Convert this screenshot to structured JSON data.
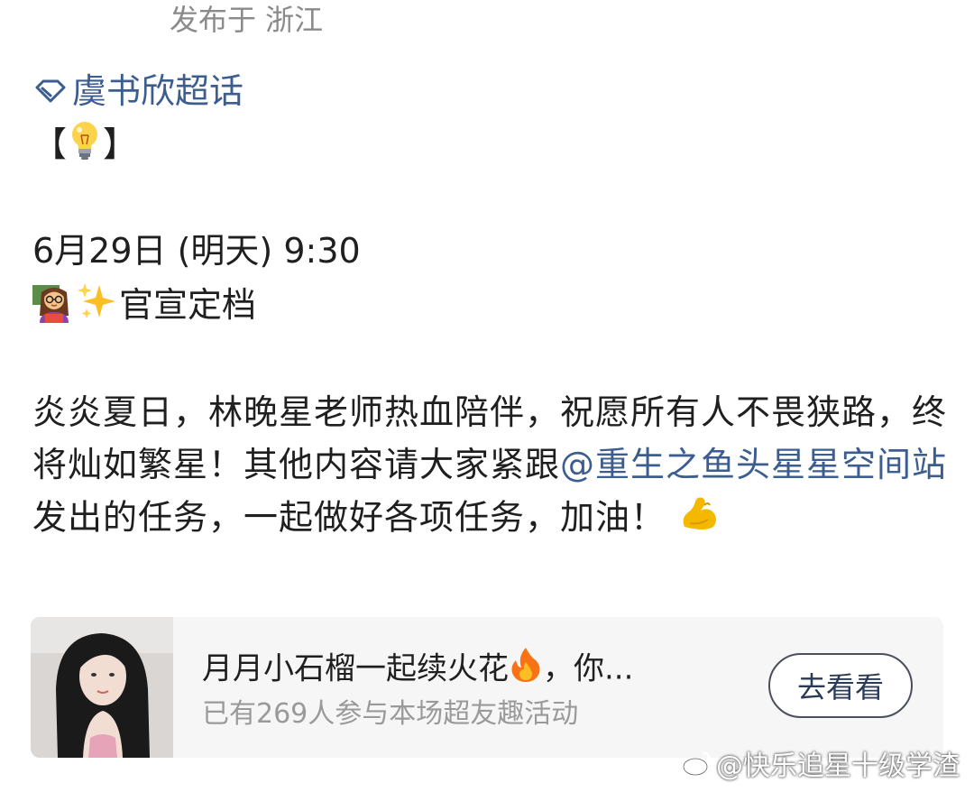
{
  "post": {
    "location": "发布于 浙江",
    "supertopic": "虞书欣超话",
    "bracket_open": "【",
    "bracket_close": "】",
    "date_line": "6月29日 (明天) 9:30",
    "announce": "官宣定档",
    "body_part1": "炎炎夏日，林晚星老师热血陪伴，祝愿所有人不畏狭路，终将灿如繁星！其他内容请大家紧跟",
    "mention": "@重生之鱼头星星空间站",
    "body_part2": " 发出的任务，一起做好各项任务，加油！"
  },
  "icons": {
    "supertopic": "diamond-icon",
    "bulb": "lightbulb-emoji",
    "teacher": "teacher-emoji",
    "sparkles": "sparkles-emoji",
    "muscle": "flexed-biceps-emoji",
    "fire": "fire-emoji",
    "weibo": "weibo-logo-icon"
  },
  "card": {
    "title": "月月小石榴一起续火花",
    "title_tail": "，你...",
    "subtitle": "已有269人参与本场超友趣活动",
    "button_label": "去看看"
  },
  "watermark": "@快乐追星十级学渣",
  "colors": {
    "link": "#3c5d8f",
    "meta": "#8a8a8a",
    "card_bg": "#f6f6f7"
  }
}
